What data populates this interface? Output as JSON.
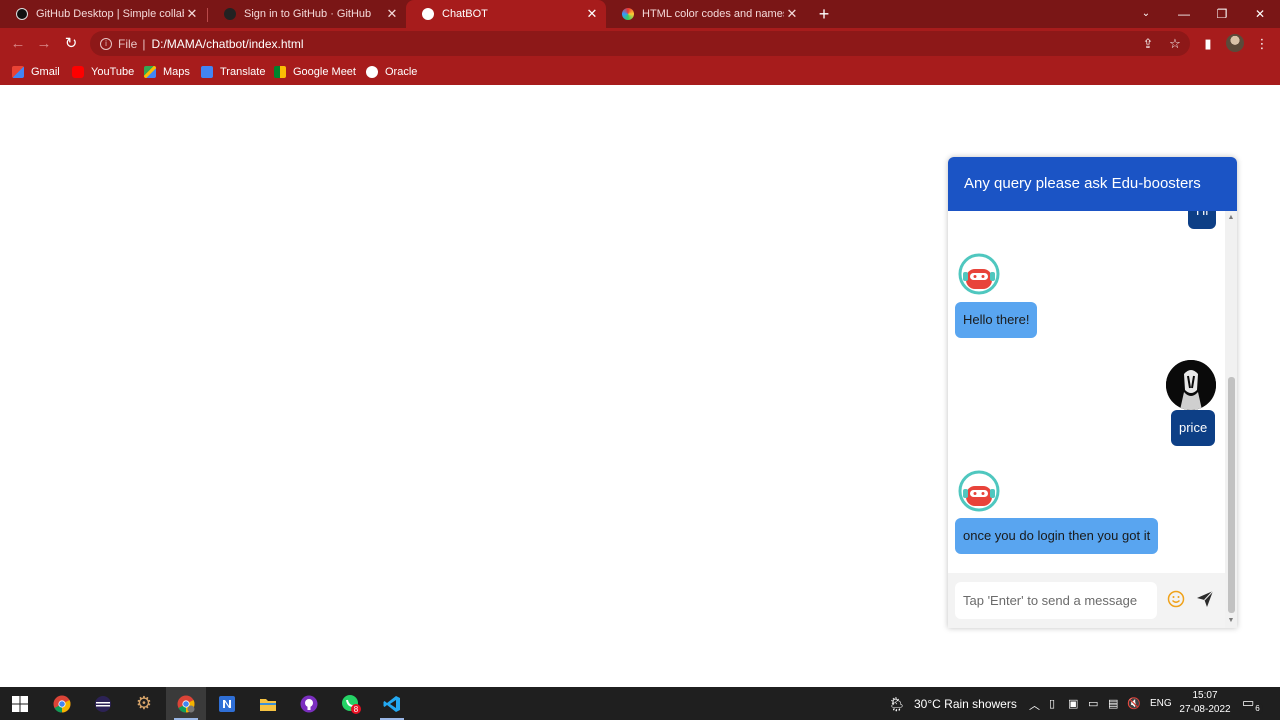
{
  "browser": {
    "tabs": [
      {
        "title": "GitHub Desktop | Simple collabo",
        "favicon": "github-icon",
        "active": false
      },
      {
        "title": "Sign in to GitHub · GitHub",
        "favicon": "github-icon",
        "active": false
      },
      {
        "title": "ChatBOT",
        "favicon": "globe-icon",
        "active": true
      },
      {
        "title": "HTML color codes and names",
        "favicon": "color-wheel-icon",
        "active": false
      }
    ],
    "address": {
      "scheme": "File",
      "url": "D:/MAMA/chatbot/index.html"
    },
    "bookmarks": [
      {
        "label": "Gmail",
        "icon": "gmail-icon"
      },
      {
        "label": "YouTube",
        "icon": "youtube-icon"
      },
      {
        "label": "Maps",
        "icon": "maps-icon"
      },
      {
        "label": "Translate",
        "icon": "translate-icon"
      },
      {
        "label": "Google Meet",
        "icon": "meet-icon"
      },
      {
        "label": "Oracle",
        "icon": "oracle-icon"
      }
    ],
    "theme_color": "#a71c1c"
  },
  "chat": {
    "header_title": "Any query please ask Edu-boosters",
    "header_color": "#1b54c5",
    "messages": [
      {
        "sender": "user",
        "text": "Hi"
      },
      {
        "sender": "bot",
        "text": "Hello there!"
      },
      {
        "sender": "user",
        "text": "price"
      },
      {
        "sender": "bot",
        "text": "once you do login then you got it"
      }
    ],
    "input_placeholder": "Tap 'Enter' to send a message",
    "bot_bubble_color": "#59a5f0",
    "user_bubble_color": "#0d3f86"
  },
  "taskbar": {
    "apps": [
      "windows-start-icon",
      "chrome-icon",
      "eclipse-icon",
      "settings-icon",
      "chrome-profile-icon",
      "notion-icon",
      "file-explorer-icon",
      "github-desktop-icon",
      "whatsapp-icon",
      "vscode-icon"
    ],
    "whatsapp_badge": "8",
    "weather": "30°C  Rain showers",
    "language": "ENG",
    "time": "15:07",
    "date": "27-08-2022",
    "notification_count": "6"
  }
}
